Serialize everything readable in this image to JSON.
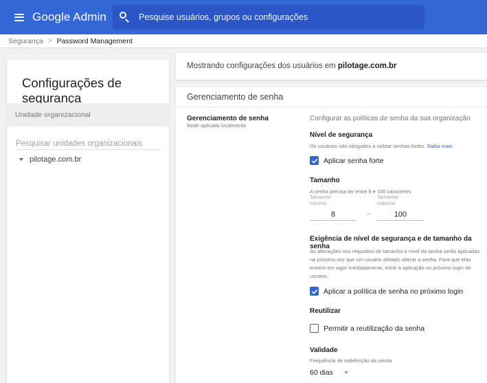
{
  "topbar": {
    "brand": "Google Admin",
    "search_placeholder": "Pesquise usuários, grupos ou configurações"
  },
  "breadcrumb": {
    "parent": "Segurança",
    "separator": ">",
    "current": "Password Management"
  },
  "left_panel": {
    "title": "Configurações de segurança",
    "ou_header": "Unidade organizacional",
    "search_placeholder": "Pesquisar unidades organizacionais",
    "org_unit": "pilotage.com.br"
  },
  "info": {
    "prefix": "Mostrando configurações dos usuários em",
    "domain": "pilotage.com.br"
  },
  "main": {
    "section_title": "Gerenciamento de senha",
    "setting_name": "Gerenciamento de senha",
    "setting_sub": "Rede aplicada localmente",
    "description": "Configurar as políticas de senha da sua organização",
    "strength": {
      "heading": "Nível de segurança",
      "help": "Os usuários são obrigados a utilizar senhas fortes.",
      "learn_more": "Saiba mais",
      "checkbox_label": "Aplicar senha forte",
      "checked": true
    },
    "length": {
      "heading": "Tamanho",
      "help": "A senha precisa ter entre 8 e 100 caracteres",
      "min_label_1": "Tamanho",
      "min_label_2": "mínimo",
      "max_label_1": "Tamanho",
      "max_label_2": "máximo",
      "min_value": "8",
      "max_value": "100",
      "dash": "–"
    },
    "enforcement": {
      "heading": "Exigência de nível de segurança e de tamanho da senha",
      "help_lines": [
        "As alterações nos requisitos de tamanho e nível da senha serão aplicadas",
        "na próxima vez que um usuário afetado alterar a senha. Para que elas",
        "entrem em vigor imediatamente, inicie a aplicação no próximo login do",
        "usuário."
      ],
      "checkbox_label": "Aplicar a política de senha no próximo login",
      "checked": true
    },
    "reuse": {
      "heading": "Reutilizar",
      "checkbox_label": "Permitir a reutilização da senha",
      "checked": false
    },
    "expiry": {
      "heading": "Validade",
      "help": "Frequência de redefinição da senha",
      "selected": "60 dias"
    }
  },
  "colors": {
    "topbar": "#3367d6",
    "search_bg": "#2a56c6",
    "checkbox_on": "#3367d6",
    "link": "#3367d6"
  }
}
